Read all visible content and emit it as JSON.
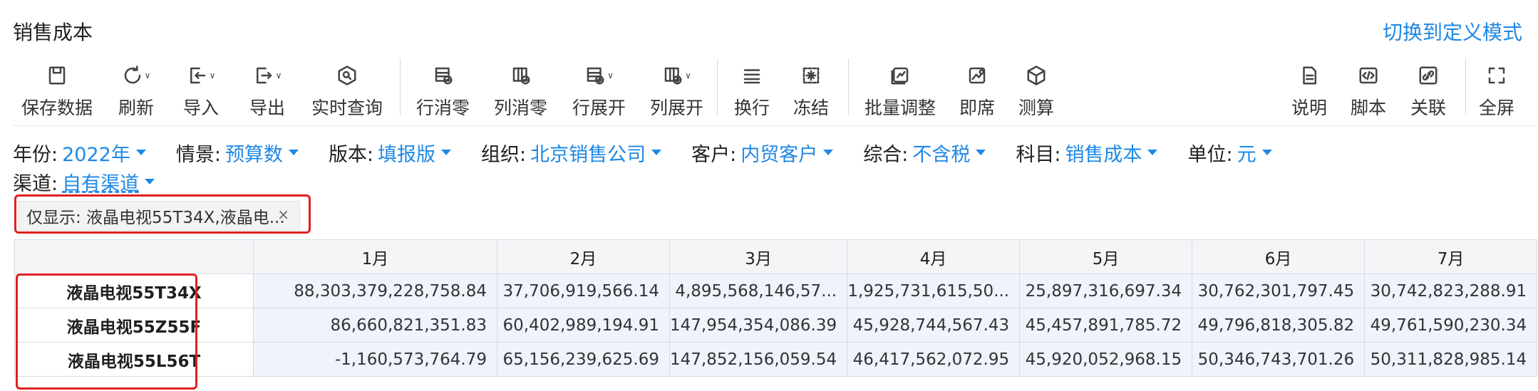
{
  "title": "销售成本",
  "switch_label": "切换到定义模式",
  "toolbar": {
    "save": "保存数据",
    "refresh": "刷新",
    "import": "导入",
    "export": "导出",
    "realtime_query": "实时查询",
    "row_zero": "行消零",
    "col_zero": "列消零",
    "row_expand": "行展开",
    "col_expand": "列展开",
    "wrap": "换行",
    "freeze": "冻结",
    "batch_adjust": "批量调整",
    "instant": "即席",
    "measure": "测算",
    "help": "说明",
    "script": "脚本",
    "link": "关联",
    "fullscreen": "全屏"
  },
  "filters": [
    {
      "key": "年份:",
      "value": "2022年"
    },
    {
      "key": "情景:",
      "value": "预算数"
    },
    {
      "key": "版本:",
      "value": "填报版"
    },
    {
      "key": "组织:",
      "value": "北京销售公司"
    },
    {
      "key": "客户:",
      "value": "内贸客户"
    },
    {
      "key": "综合:",
      "value": "不含税"
    },
    {
      "key": "科目:",
      "value": "销售成本"
    },
    {
      "key": "单位:",
      "value": "元"
    },
    {
      "key": "渠道:",
      "value": "自有渠道"
    }
  ],
  "chip": {
    "text": "仅显示: 液晶电视55T34X,液晶电...",
    "close": "×"
  },
  "table": {
    "columns": [
      "",
      "1月",
      "2月",
      "3月",
      "4月",
      "5月",
      "6月",
      "7月"
    ],
    "rows": [
      {
        "label": "液晶电视55T34X",
        "values": [
          "88,303,379,228,758.84",
          "37,706,919,566.14",
          "4,895,568,146,57...",
          "1,925,731,615,50...",
          "25,897,316,697.34",
          "30,762,301,797.45",
          "30,742,823,288.91"
        ]
      },
      {
        "label": "液晶电视55Z55F",
        "values": [
          "86,660,821,351.83",
          "60,402,989,194.91",
          "147,954,354,086.39",
          "45,928,744,567.43",
          "45,457,891,785.72",
          "49,796,818,305.82",
          "49,761,590,230.34"
        ]
      },
      {
        "label": "液晶电视55L56T",
        "values": [
          "-1,160,573,764.79",
          "65,156,239,625.69",
          "147,852,156,059.54",
          "46,417,562,072.95",
          "45,920,052,968.15",
          "50,346,743,701.26",
          "50,311,828,985.14"
        ]
      }
    ]
  }
}
